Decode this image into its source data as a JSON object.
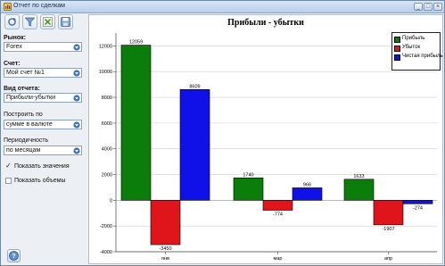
{
  "window": {
    "title": "Отчет по сделкам"
  },
  "left_panel": {
    "market_label": "Рынок:",
    "market_value": "Forex",
    "account_label": "Счет:",
    "account_value": "Мой счет №1",
    "report_type_label": "Вид отчета:",
    "report_type_value": "Прибыли-убытки",
    "build_by_label": "Построить по",
    "build_by_value": "сумме в валюте",
    "periodicity_label": "Периодичность",
    "periodicity_value": "по месяцам",
    "show_values_label": "Показать значения",
    "show_values_checked": true,
    "show_volumes_label": "Показать объемы",
    "show_volumes_checked": false
  },
  "chart_data": {
    "type": "bar",
    "title": "Прибыли - убытки",
    "categories": [
      "янв",
      "мар",
      "апр"
    ],
    "series": [
      {
        "name": "Прибыль",
        "color": "#0a7d0a",
        "values": [
          12059,
          1740,
          1633
        ]
      },
      {
        "name": "Убыток",
        "color": "#e0141b",
        "values": [
          -3450,
          -774,
          -1907
        ]
      },
      {
        "name": "Чистая прибыль",
        "color": "#1010e8",
        "values": [
          8609,
          966,
          -274
        ]
      }
    ],
    "yticks": [
      -4000,
      -2000,
      0,
      2000,
      4000,
      6000,
      8000,
      10000,
      12000
    ],
    "ylim": [
      -4000,
      13000
    ],
    "grid": true,
    "legend_position": "top-right"
  }
}
